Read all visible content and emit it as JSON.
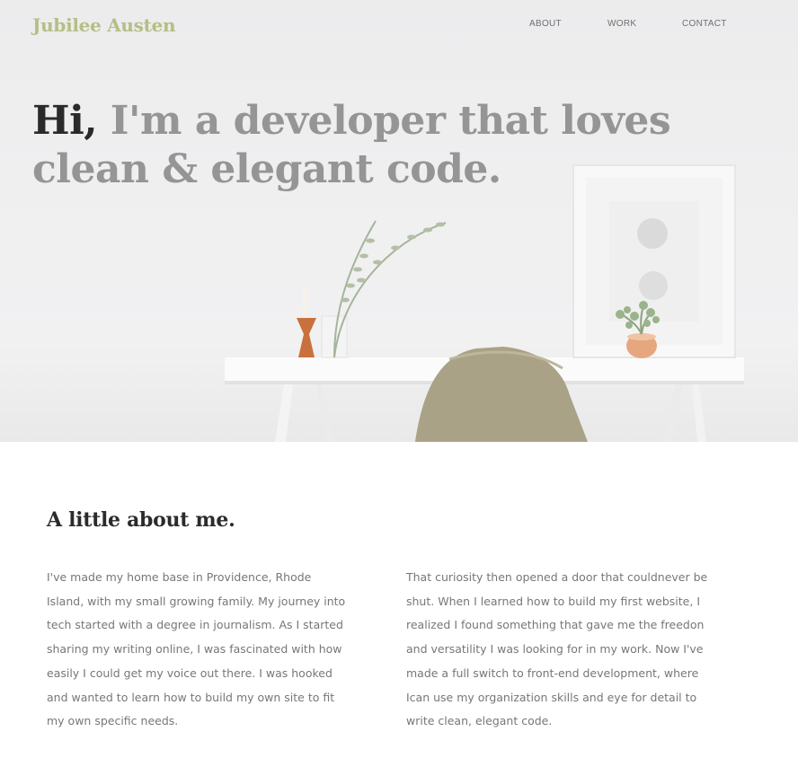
{
  "brand": {
    "name": "Jubilee Austen"
  },
  "nav": {
    "items": [
      "ABOUT",
      "WORK",
      "CONTACT"
    ]
  },
  "hero": {
    "greeting": "Hi,",
    "headline_rest": " I'm a developer that loves clean & elegant code."
  },
  "about": {
    "title": "A little about me.",
    "paragraphs": [
      "I've made my home base in Providence, Rhode Island, with my small growing family. My journey into tech started with a degree in journalism. As I started sharing my writing online, I was fascinated with how easily I could get my voice out there. I was hooked and wanted to learn how to build my own site to fit my own specific needs.",
      "That curiosity then opened a door that couldnever be shut. When I learned how to build my first website, I realized I found something that gave me the freedon and versatility I was looking for in my work. Now I've made a full switch to front-end development, where Ican use my organization skills and eye for detail to write clean, elegant code."
    ]
  },
  "colors": {
    "brand": "#b6bd86",
    "headline_accent": "#2a2a2a",
    "headline": "#959595",
    "body_text": "#777777"
  }
}
